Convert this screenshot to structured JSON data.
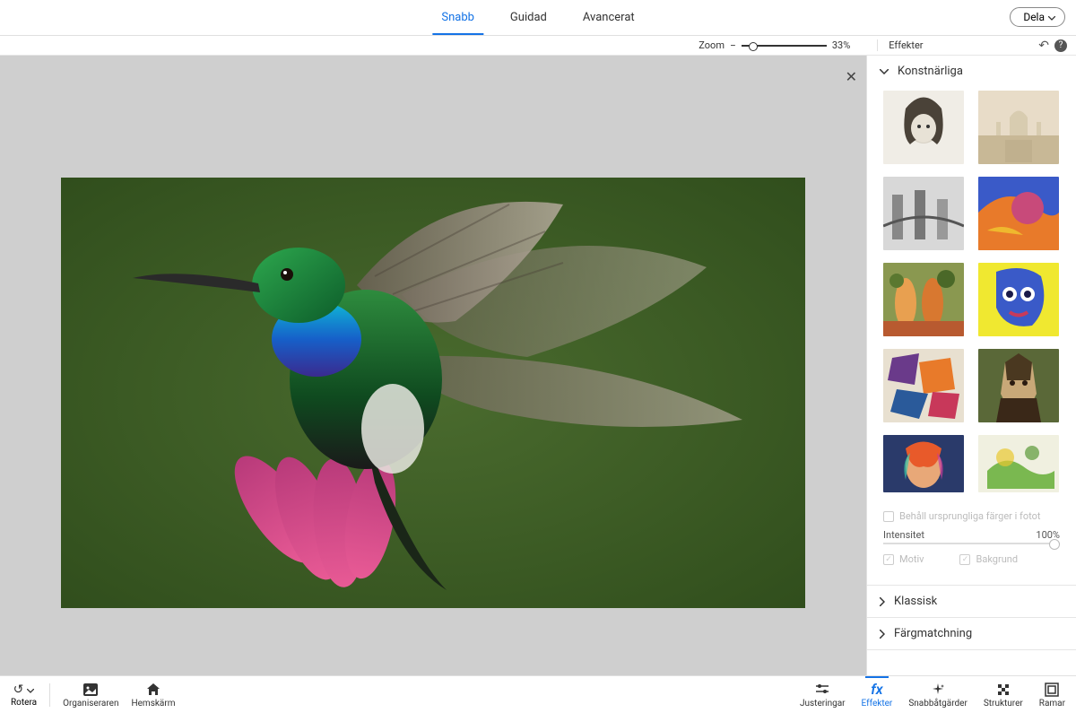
{
  "topbar": {
    "tabs": [
      {
        "label": "Snabb",
        "active": true
      },
      {
        "label": "Guidad",
        "active": false
      },
      {
        "label": "Avancerat",
        "active": false
      }
    ],
    "share_label": "Dela"
  },
  "zoombar": {
    "zoom_label": "Zoom",
    "zoom_value": "33%",
    "panel_title": "Effekter"
  },
  "right_panel": {
    "sections": [
      {
        "title": "Konstnärliga",
        "expanded": true
      },
      {
        "title": "Klassisk",
        "expanded": false
      },
      {
        "title": "Färgmatchning",
        "expanded": false
      }
    ],
    "keep_colors_label": "Behåll ursprungliga färger i fotot",
    "intensity_label": "Intensitet",
    "intensity_value": "100%",
    "subject_label": "Motiv",
    "background_label": "Bakgrund"
  },
  "bottombar": {
    "rotate_label": "Rotera",
    "left_tools": [
      {
        "label": "Organiseraren",
        "icon": "organizer"
      },
      {
        "label": "Hemskärm",
        "icon": "home"
      }
    ],
    "right_tools": [
      {
        "label": "Justeringar",
        "icon": "sliders",
        "active": false
      },
      {
        "label": "Effekter",
        "icon": "fx",
        "active": true
      },
      {
        "label": "Snabbåtgärder",
        "icon": "sparkle",
        "active": false
      },
      {
        "label": "Strukturer",
        "icon": "texture",
        "active": false
      },
      {
        "label": "Ramar",
        "icon": "frame",
        "active": false
      }
    ]
  }
}
